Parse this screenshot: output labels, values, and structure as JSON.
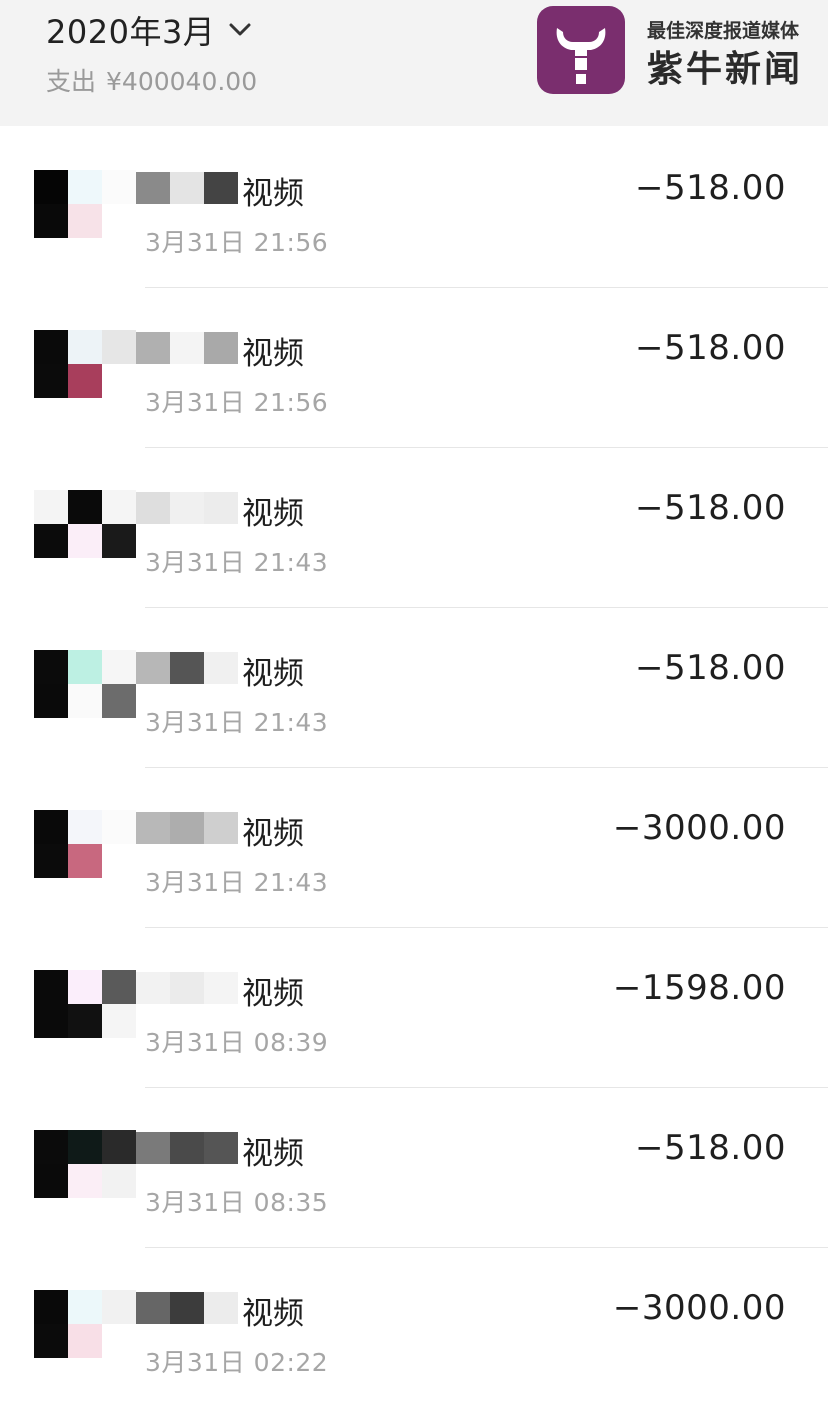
{
  "header": {
    "month": "2020年3月",
    "expense_label": "支出",
    "expense_amount": "¥400040.00"
  },
  "watermark": {
    "tagline": "最佳深度报道媒体",
    "name": "紫牛新闻",
    "brand_color": "#7a2e6e"
  },
  "transactions": [
    {
      "title": "视频",
      "time": "3月31日 21:56",
      "amount": "−518.00"
    },
    {
      "title": "视频",
      "time": "3月31日 21:56",
      "amount": "−518.00"
    },
    {
      "title": "视频",
      "time": "3月31日 21:43",
      "amount": "−518.00"
    },
    {
      "title": "视频",
      "time": "3月31日 21:43",
      "amount": "−518.00"
    },
    {
      "title": "视频",
      "time": "3月31日 21:43",
      "amount": "−3000.00"
    },
    {
      "title": "视频",
      "time": "3月31日 08:39",
      "amount": "−1598.00"
    },
    {
      "title": "视频",
      "time": "3月31日 08:35",
      "amount": "−518.00"
    },
    {
      "title": "视频",
      "time": "3月31日 02:22",
      "amount": "−3000.00"
    }
  ],
  "icons": {
    "month_dropdown": "chevron-down-icon",
    "logo": "bull-logo-icon"
  }
}
